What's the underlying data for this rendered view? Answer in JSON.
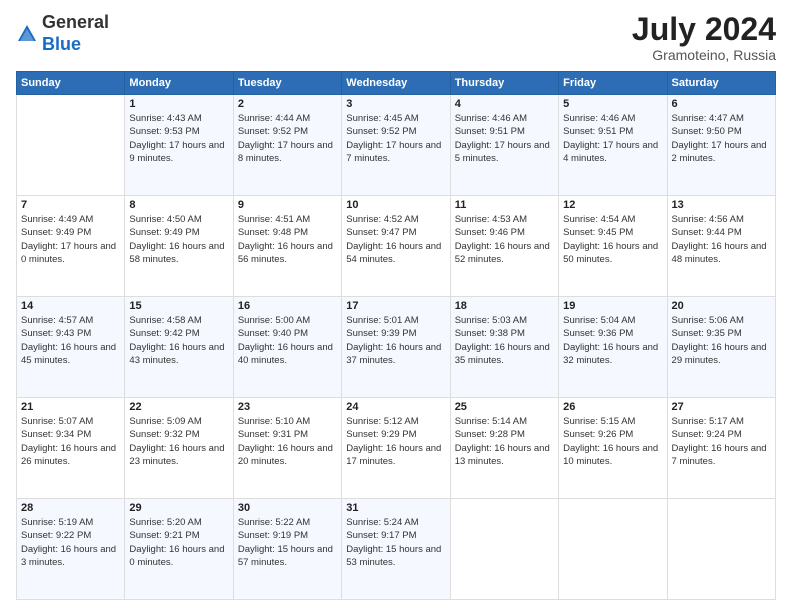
{
  "header": {
    "logo": {
      "general": "General",
      "blue": "Blue"
    },
    "title": "July 2024",
    "location": "Gramoteino, Russia"
  },
  "calendar": {
    "days_of_week": [
      "Sunday",
      "Monday",
      "Tuesday",
      "Wednesday",
      "Thursday",
      "Friday",
      "Saturday"
    ],
    "weeks": [
      [
        {
          "day": "",
          "info": ""
        },
        {
          "day": "1",
          "info": "Sunrise: 4:43 AM\nSunset: 9:53 PM\nDaylight: 17 hours\nand 9 minutes."
        },
        {
          "day": "2",
          "info": "Sunrise: 4:44 AM\nSunset: 9:52 PM\nDaylight: 17 hours\nand 8 minutes."
        },
        {
          "day": "3",
          "info": "Sunrise: 4:45 AM\nSunset: 9:52 PM\nDaylight: 17 hours\nand 7 minutes."
        },
        {
          "day": "4",
          "info": "Sunrise: 4:46 AM\nSunset: 9:51 PM\nDaylight: 17 hours\nand 5 minutes."
        },
        {
          "day": "5",
          "info": "Sunrise: 4:46 AM\nSunset: 9:51 PM\nDaylight: 17 hours\nand 4 minutes."
        },
        {
          "day": "6",
          "info": "Sunrise: 4:47 AM\nSunset: 9:50 PM\nDaylight: 17 hours\nand 2 minutes."
        }
      ],
      [
        {
          "day": "7",
          "info": "Sunrise: 4:49 AM\nSunset: 9:49 PM\nDaylight: 17 hours\nand 0 minutes."
        },
        {
          "day": "8",
          "info": "Sunrise: 4:50 AM\nSunset: 9:49 PM\nDaylight: 16 hours\nand 58 minutes."
        },
        {
          "day": "9",
          "info": "Sunrise: 4:51 AM\nSunset: 9:48 PM\nDaylight: 16 hours\nand 56 minutes."
        },
        {
          "day": "10",
          "info": "Sunrise: 4:52 AM\nSunset: 9:47 PM\nDaylight: 16 hours\nand 54 minutes."
        },
        {
          "day": "11",
          "info": "Sunrise: 4:53 AM\nSunset: 9:46 PM\nDaylight: 16 hours\nand 52 minutes."
        },
        {
          "day": "12",
          "info": "Sunrise: 4:54 AM\nSunset: 9:45 PM\nDaylight: 16 hours\nand 50 minutes."
        },
        {
          "day": "13",
          "info": "Sunrise: 4:56 AM\nSunset: 9:44 PM\nDaylight: 16 hours\nand 48 minutes."
        }
      ],
      [
        {
          "day": "14",
          "info": "Sunrise: 4:57 AM\nSunset: 9:43 PM\nDaylight: 16 hours\nand 45 minutes."
        },
        {
          "day": "15",
          "info": "Sunrise: 4:58 AM\nSunset: 9:42 PM\nDaylight: 16 hours\nand 43 minutes."
        },
        {
          "day": "16",
          "info": "Sunrise: 5:00 AM\nSunset: 9:40 PM\nDaylight: 16 hours\nand 40 minutes."
        },
        {
          "day": "17",
          "info": "Sunrise: 5:01 AM\nSunset: 9:39 PM\nDaylight: 16 hours\nand 37 minutes."
        },
        {
          "day": "18",
          "info": "Sunrise: 5:03 AM\nSunset: 9:38 PM\nDaylight: 16 hours\nand 35 minutes."
        },
        {
          "day": "19",
          "info": "Sunrise: 5:04 AM\nSunset: 9:36 PM\nDaylight: 16 hours\nand 32 minutes."
        },
        {
          "day": "20",
          "info": "Sunrise: 5:06 AM\nSunset: 9:35 PM\nDaylight: 16 hours\nand 29 minutes."
        }
      ],
      [
        {
          "day": "21",
          "info": "Sunrise: 5:07 AM\nSunset: 9:34 PM\nDaylight: 16 hours\nand 26 minutes."
        },
        {
          "day": "22",
          "info": "Sunrise: 5:09 AM\nSunset: 9:32 PM\nDaylight: 16 hours\nand 23 minutes."
        },
        {
          "day": "23",
          "info": "Sunrise: 5:10 AM\nSunset: 9:31 PM\nDaylight: 16 hours\nand 20 minutes."
        },
        {
          "day": "24",
          "info": "Sunrise: 5:12 AM\nSunset: 9:29 PM\nDaylight: 16 hours\nand 17 minutes."
        },
        {
          "day": "25",
          "info": "Sunrise: 5:14 AM\nSunset: 9:28 PM\nDaylight: 16 hours\nand 13 minutes."
        },
        {
          "day": "26",
          "info": "Sunrise: 5:15 AM\nSunset: 9:26 PM\nDaylight: 16 hours\nand 10 minutes."
        },
        {
          "day": "27",
          "info": "Sunrise: 5:17 AM\nSunset: 9:24 PM\nDaylight: 16 hours\nand 7 minutes."
        }
      ],
      [
        {
          "day": "28",
          "info": "Sunrise: 5:19 AM\nSunset: 9:22 PM\nDaylight: 16 hours\nand 3 minutes."
        },
        {
          "day": "29",
          "info": "Sunrise: 5:20 AM\nSunset: 9:21 PM\nDaylight: 16 hours\nand 0 minutes."
        },
        {
          "day": "30",
          "info": "Sunrise: 5:22 AM\nSunset: 9:19 PM\nDaylight: 15 hours\nand 57 minutes."
        },
        {
          "day": "31",
          "info": "Sunrise: 5:24 AM\nSunset: 9:17 PM\nDaylight: 15 hours\nand 53 minutes."
        },
        {
          "day": "",
          "info": ""
        },
        {
          "day": "",
          "info": ""
        },
        {
          "day": "",
          "info": ""
        }
      ]
    ]
  }
}
